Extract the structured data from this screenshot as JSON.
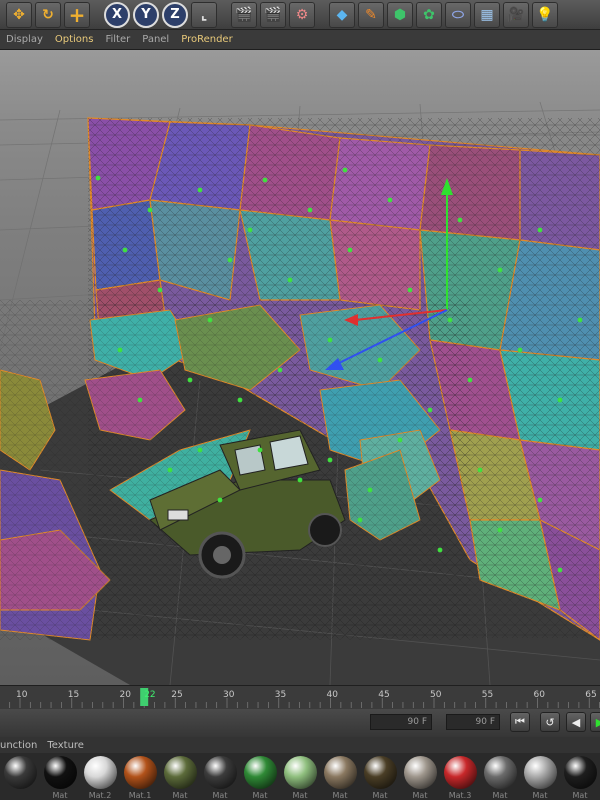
{
  "toolbar": {
    "buttons": [
      {
        "name": "move-icon",
        "glyph": "✥",
        "color": "#e8a43a"
      },
      {
        "name": "rotate-icon",
        "glyph": "↻",
        "color": "#e8a43a"
      },
      {
        "name": "scale-icon",
        "glyph": "+",
        "color": "#f0b030"
      }
    ],
    "axis_buttons": [
      "X",
      "Y",
      "Z"
    ],
    "right_icons": [
      "coordinate-system-icon",
      "render-view-icon",
      "render-picture-queue-icon",
      "render-settings-icon",
      "cube-primitive-icon",
      "spline-pen-icon",
      "generator-icon",
      "deformer-icon",
      "scene-environment-icon",
      "floor-icon",
      "camera-icon",
      "light-bulb-icon"
    ]
  },
  "menubar": {
    "items": [
      "Display",
      "Options",
      "Filter",
      "Panel",
      "ProRender"
    ],
    "active": "Options"
  },
  "timeline": {
    "ticks": [
      "10",
      "15",
      "20",
      "22",
      "25",
      "30",
      "35",
      "40",
      "45",
      "50",
      "55",
      "60",
      "65"
    ],
    "current_frame": "22"
  },
  "transport": {
    "end_frame_a": "90 F",
    "end_frame_b": "90 F"
  },
  "materials_menu": [
    "unction",
    "Texture"
  ],
  "materials": [
    {
      "color": "#3a3a3a",
      "label": ""
    },
    {
      "color": "#111111",
      "label": "Mat"
    },
    {
      "color": "#d8d8d8",
      "label": "Mat.2"
    },
    {
      "color": "#b2521a",
      "label": "Mat.1"
    },
    {
      "color": "#5c6b3a",
      "label": "Mat"
    },
    {
      "color": "#3c3c3c",
      "label": "Mat"
    },
    {
      "color": "#2f8a36",
      "label": "Mat"
    },
    {
      "color": "#8fbf7e",
      "label": "Mat"
    },
    {
      "color": "#8a7860",
      "label": "Mat"
    },
    {
      "color": "#4a3e26",
      "label": "Mat"
    },
    {
      "color": "#9e968c",
      "label": "Mat"
    },
    {
      "color": "#c8282a",
      "label": "Mat.3"
    },
    {
      "color": "#6b6b6b",
      "label": "Mat"
    },
    {
      "color": "#aaaaaa",
      "label": "Mat"
    },
    {
      "color": "#1e1e1e",
      "label": "Mat"
    }
  ]
}
